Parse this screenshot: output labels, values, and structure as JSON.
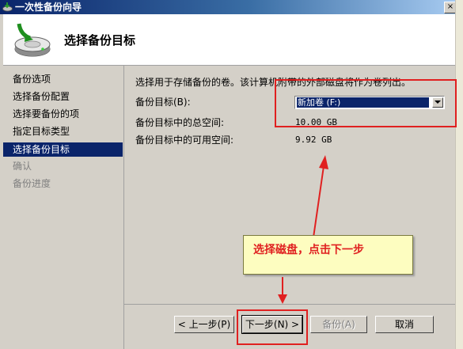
{
  "window": {
    "title": "一次性备份向导",
    "close_glyph": "×"
  },
  "header": {
    "title": "选择备份目标",
    "icon": "backup-disk-icon"
  },
  "nav": {
    "items": [
      {
        "label": "备份选项",
        "state": "normal"
      },
      {
        "label": "选择备份配置",
        "state": "normal"
      },
      {
        "label": "选择要备份的项",
        "state": "normal"
      },
      {
        "label": "指定目标类型",
        "state": "normal"
      },
      {
        "label": "选择备份目标",
        "state": "selected"
      },
      {
        "label": "确认",
        "state": "disabled"
      },
      {
        "label": "备份进度",
        "state": "disabled"
      }
    ]
  },
  "main": {
    "instruction": "选择用于存储备份的卷。该计算机附带的外部磁盘将作为卷列出。",
    "destination_label": "备份目标(B):",
    "destination_value": "新加卷 (F:)",
    "total_space_label": "备份目标中的总空间:",
    "total_space_value": "10.00 GB",
    "free_space_label": "备份目标中的可用空间:",
    "free_space_value": "9.92 GB"
  },
  "buttons": {
    "back": "< 上一步(P)",
    "next": "下一步(N) >",
    "backup": "备份(A)",
    "cancel": "取消"
  },
  "annotation": {
    "callout_text": "选择磁盘，点击下一步",
    "highlight_color": "#e02020"
  },
  "colors": {
    "selection_bg": "#0a246a",
    "dialog_bg": "#d4d0c8"
  }
}
